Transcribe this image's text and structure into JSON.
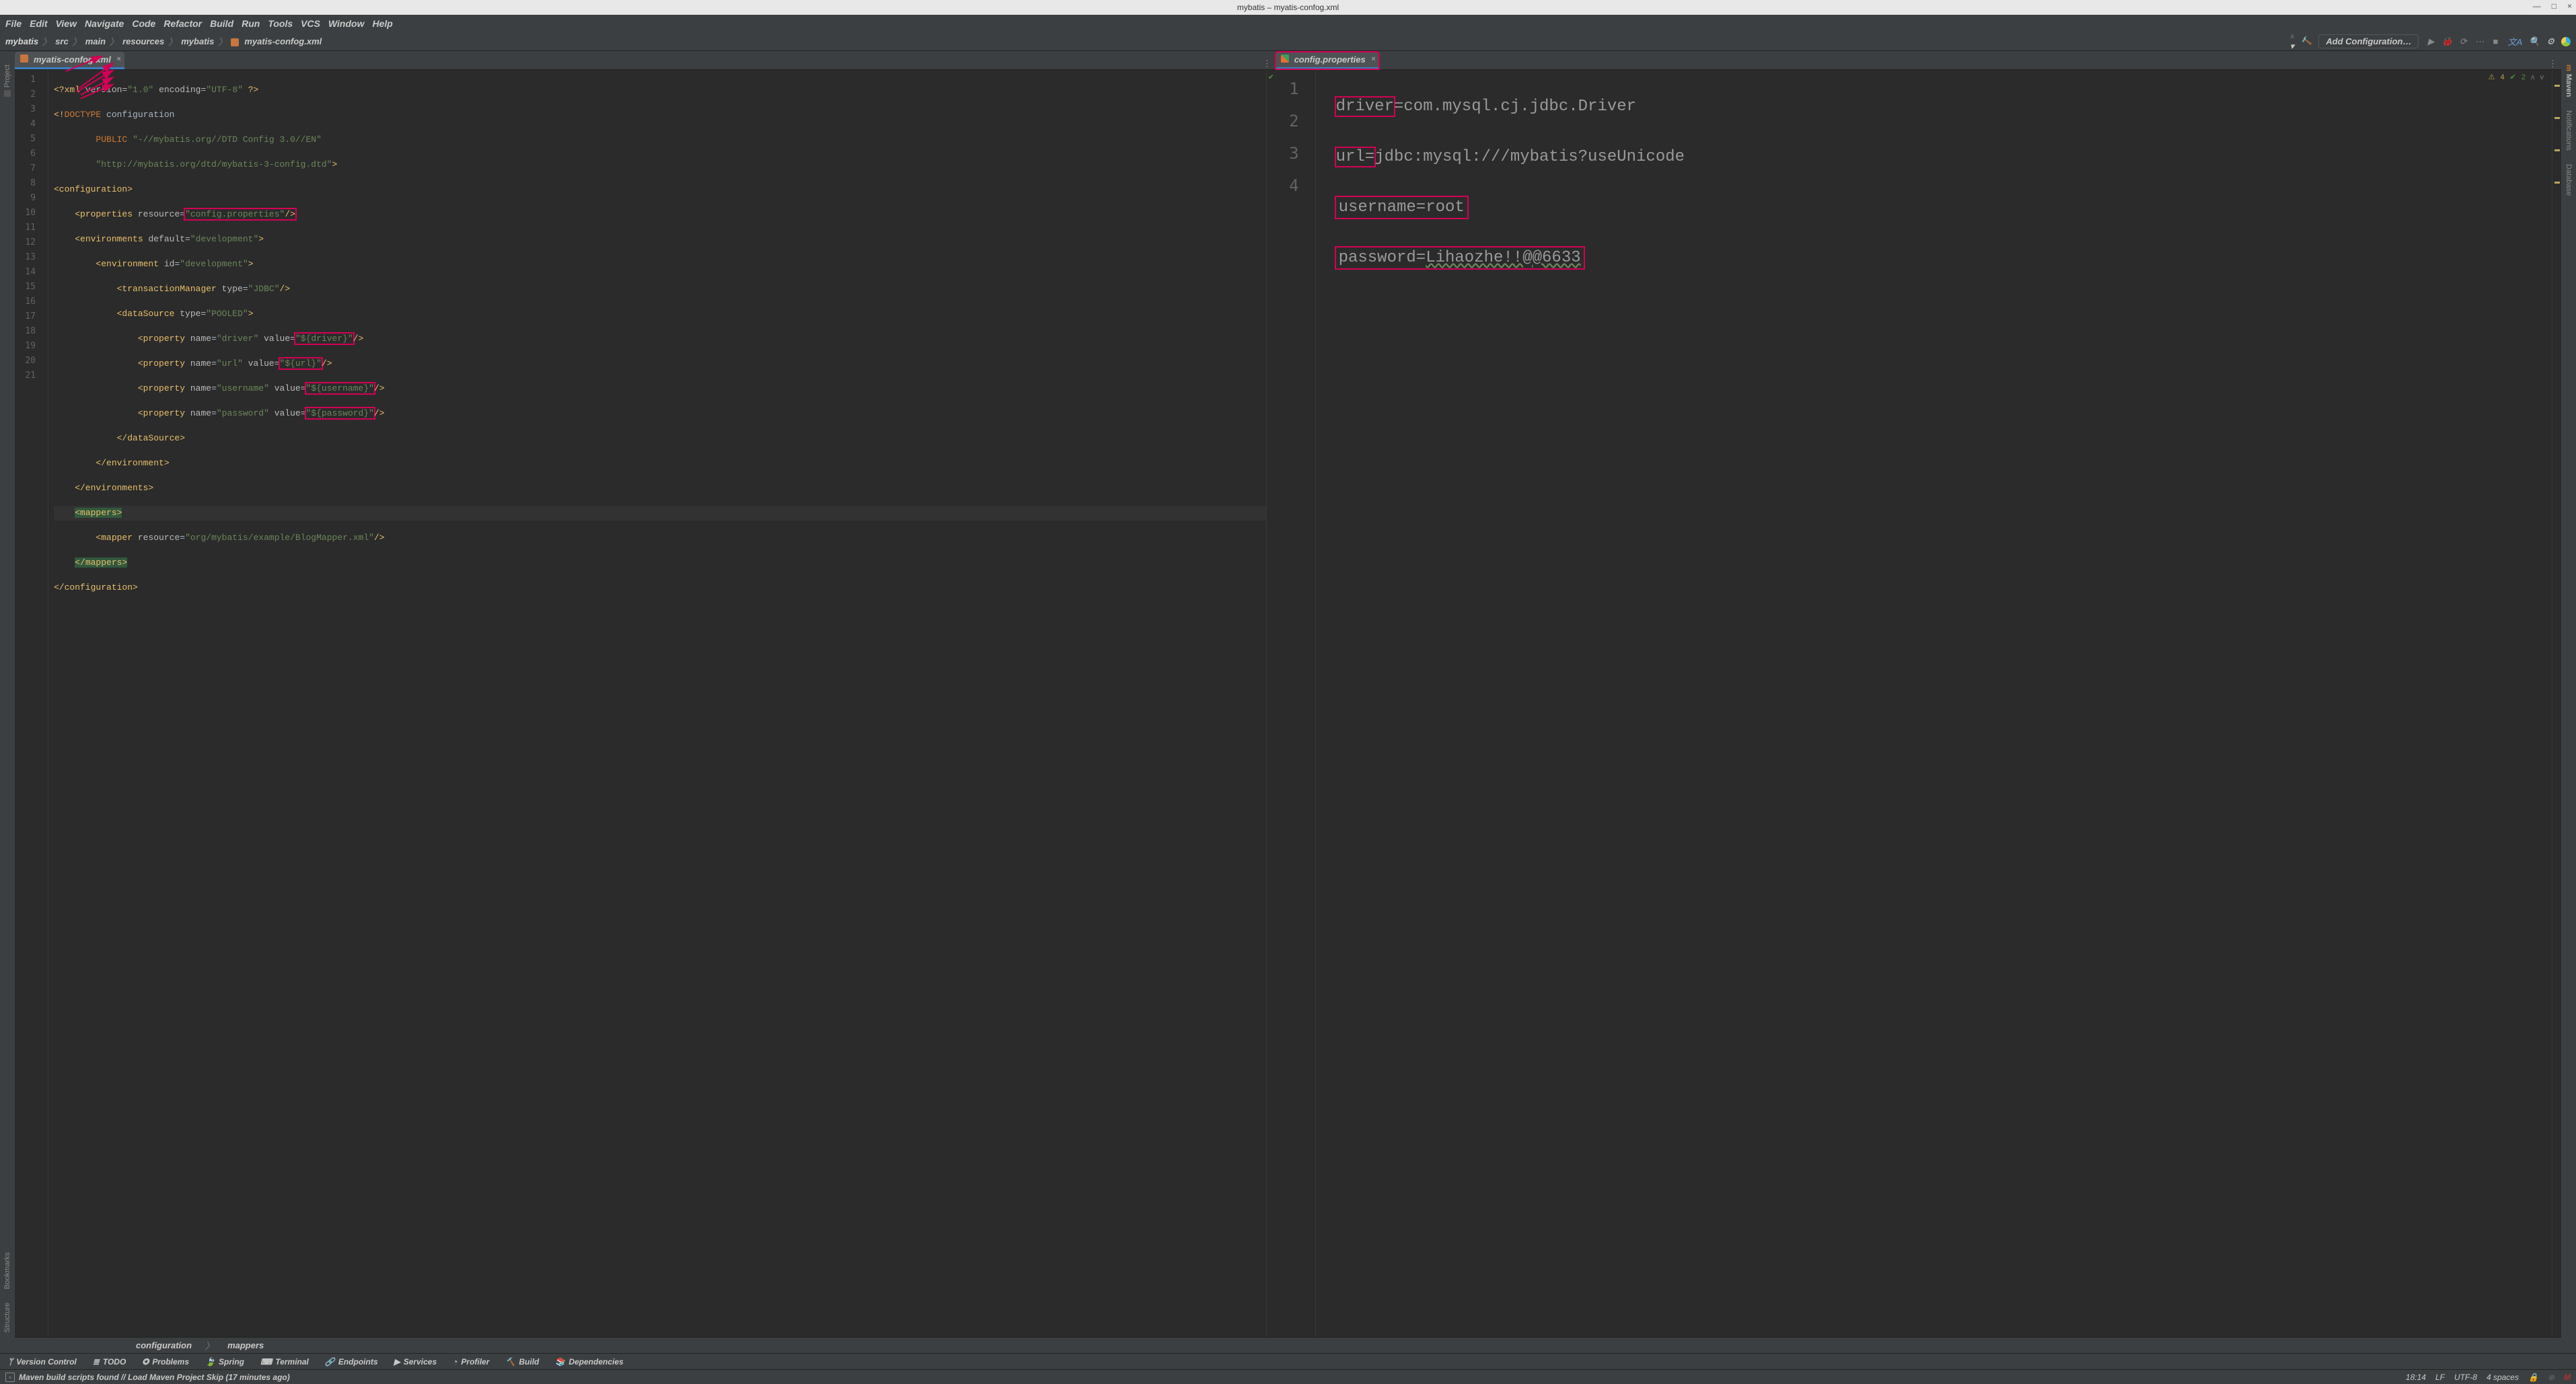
{
  "os_title": "mybatis – myatis-confog.xml",
  "window_controls": {
    "min": "—",
    "max": "□",
    "close": "×"
  },
  "menu": [
    "File",
    "Edit",
    "View",
    "Navigate",
    "Code",
    "Refactor",
    "Build",
    "Run",
    "Tools",
    "VCS",
    "Window",
    "Help"
  ],
  "breadcrumb": {
    "parts": [
      "mybatis",
      "src",
      "main",
      "resources",
      "mybatis",
      "myatis-confog.xml"
    ]
  },
  "toolbar": {
    "add_config": "Add Configuration…"
  },
  "left_editor": {
    "tab": "myatis-confog.xml",
    "gutter": [
      "1",
      "2",
      "3",
      "4",
      "5",
      "6",
      "7",
      "8",
      "9",
      "10",
      "11",
      "12",
      "13",
      "14",
      "15",
      "16",
      "17",
      "18",
      "19",
      "20",
      "21"
    ],
    "lines": {
      "l1_pi_open": "<?",
      "l1_xml": "xml ",
      "l1_ver_a": "version",
      "l1_eq": "=",
      "l1_ver_v": "\"1.0\"",
      "l1_sp": " ",
      "l1_enc_a": "encoding",
      "l1_enc_v": "\"UTF-8\"",
      "l1_pi_close": " ?>",
      "l2_open": "<!",
      "l2_doctype": "DOCTYPE ",
      "l2_root": "configuration",
      "l3_pub": "        PUBLIC ",
      "l3_pub_v": "\"-//mybatis.org//DTD Config 3.0//EN\"",
      "l4_sys": "        ",
      "l4_sys_v": "\"http://mybatis.org/dtd/mybatis-3-config.dtd\"",
      "l4_close": ">",
      "l5": "<configuration>",
      "l6_in": "    ",
      "l6_tag": "<properties ",
      "l6_a": "resource",
      "l6_v": "\"config.properties\"",
      "l6_end": "/>",
      "l7_in": "    ",
      "l7_tag": "<environments ",
      "l7_a": "default",
      "l7_v": "\"development\"",
      "l7_end": ">",
      "l8_in": "        ",
      "l8_tag": "<environment ",
      "l8_a": "id",
      "l8_v": "\"development\"",
      "l8_end": ">",
      "l9_in": "            ",
      "l9_tag": "<transactionManager ",
      "l9_a": "type",
      "l9_v": "\"JDBC\"",
      "l9_end": "/>",
      "l10_in": "            ",
      "l10_tag": "<dataSource ",
      "l10_a": "type",
      "l10_v": "\"POOLED\"",
      "l10_end": ">",
      "l11_in": "                ",
      "l11_tag": "<property ",
      "l11_na": "name",
      "l11_nv": "\"driver\"",
      "l11_sp": " ",
      "l11_va": "value",
      "l11_vv": "\"${driver}\"",
      "l11_end": "/>",
      "l12_in": "                ",
      "l12_tag": "<property ",
      "l12_na": "name",
      "l12_nv": "\"url\"",
      "l12_sp": " ",
      "l12_va": "value",
      "l12_vv": "\"${url}\"",
      "l12_end": "/>",
      "l13_in": "                ",
      "l13_tag": "<property ",
      "l13_na": "name",
      "l13_nv": "\"username\"",
      "l13_sp": " ",
      "l13_va": "value",
      "l13_vv": "\"${username}\"",
      "l13_end": "/>",
      "l14_in": "                ",
      "l14_tag": "<property ",
      "l14_na": "name",
      "l14_nv": "\"password\"",
      "l14_sp": " ",
      "l14_va": "value",
      "l14_vv": "\"${password}\"",
      "l14_end": "/>",
      "l15": "            </dataSource>",
      "l16": "        </environment>",
      "l17": "    </environments>",
      "l18_in": "    ",
      "l18_tag": "<mappers>",
      "l19_in": "        ",
      "l19_tag": "<mapper ",
      "l19_a": "resource",
      "l19_v": "\"org/mybatis/example/BlogMapper.xml\"",
      "l19_end": "/>",
      "l20_in": "    ",
      "l20_tag": "</mappers>",
      "l21": "</configuration>"
    },
    "crumb": [
      "configuration",
      "mappers"
    ]
  },
  "right_editor": {
    "tab": "config.properties",
    "inspection": {
      "warn_icon": "⚠",
      "warn_count": "4",
      "ok_icon": "✔",
      "ok_count": "2"
    },
    "gutter": [
      "1",
      "2",
      "3",
      "4"
    ],
    "lines": {
      "k1": "driver",
      "eq": "=",
      "v1": "com.mysql.cj.jdbc.Driver",
      "k2": "url",
      "v2pre": "=",
      "v2": "jdbc:mysql:///mybatis?useUnicode",
      "k3": "username",
      "v3": "root",
      "k4": "password",
      "v4": "Lihaozhe!!@@6633"
    }
  },
  "left_tools": [
    "Project",
    "Bookmarks",
    "Structure"
  ],
  "right_tools": [
    "Maven",
    "Notifications",
    "Database"
  ],
  "bottom_tools": [
    "Version Control",
    "TODO",
    "Problems",
    "Spring",
    "Terminal",
    "Endpoints",
    "Services",
    "Profiler",
    "Build",
    "Dependencies"
  ],
  "status": {
    "msg": "Maven build scripts found // Load Maven Project   Skip (17 minutes ago)",
    "time": "18:14",
    "le": "LF",
    "enc": "UTF-8",
    "indent": "4 spaces"
  }
}
